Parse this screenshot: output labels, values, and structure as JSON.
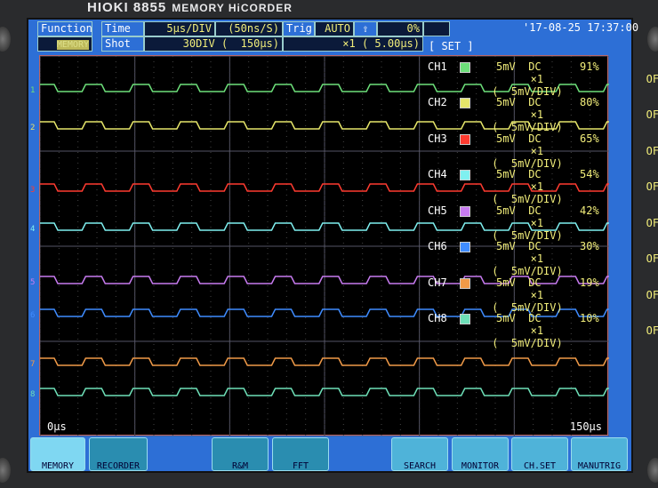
{
  "device": {
    "brand": "HIOKI",
    "model": "8855",
    "name": "MEMORY HiCORDER"
  },
  "header": {
    "function_label": "Function",
    "function_value": "MEMORY",
    "time_label": "Time",
    "time_value": "5µs/DIV",
    "sample_rate": "(50ns/S)",
    "trig_label": "Trig",
    "trig_mode": "AUTO",
    "trig_pct": "0%",
    "shot_label": "Shot",
    "shot_value": "30DIV (  150µs)",
    "mag": "×1 ( 5.00µs)",
    "set": "[ SET ]",
    "datetime": "'17-08-25 17:37:00"
  },
  "plot": {
    "x_start": "0µs",
    "x_end": "150µs"
  },
  "channels": [
    {
      "name": "CH1",
      "num": "1",
      "color": "#6de07a",
      "range": "5mV",
      "coupling": "DC",
      "mult": "×1",
      "div": "(  5mV/DIV)",
      "pos": "91%",
      "filter": "OFF"
    },
    {
      "name": "CH2",
      "num": "2",
      "color": "#e6e66a",
      "range": "5mV",
      "coupling": "DC",
      "mult": "×1",
      "div": "(  5mV/DIV)",
      "pos": "80%",
      "filter": "OFF"
    },
    {
      "name": "CH3",
      "num": "3",
      "color": "#ff3b30",
      "range": "5mV",
      "coupling": "DC",
      "mult": "×1",
      "div": "(  5mV/DIV)",
      "pos": "65%",
      "filter": "OFF"
    },
    {
      "name": "CH4",
      "num": "4",
      "color": "#7ff0f0",
      "range": "5mV",
      "coupling": "DC",
      "mult": "×1",
      "div": "(  5mV/DIV)",
      "pos": "54%",
      "filter": "OFF"
    },
    {
      "name": "CH5",
      "num": "5",
      "color": "#c77bf0",
      "range": "5mV",
      "coupling": "DC",
      "mult": "×1",
      "div": "(  5mV/DIV)",
      "pos": "42%",
      "filter": "OFF"
    },
    {
      "name": "CH6",
      "num": "6",
      "color": "#3f8cff",
      "range": "5mV",
      "coupling": "DC",
      "mult": "×1",
      "div": "(  5mV/DIV)",
      "pos": "30%",
      "filter": "OFF"
    },
    {
      "name": "CH7",
      "num": "7",
      "color": "#f09a48",
      "range": "5mV",
      "coupling": "DC",
      "mult": "×1",
      "div": "(  5mV/DIV)",
      "pos": "19%",
      "filter": "OFF"
    },
    {
      "name": "CH8",
      "num": "8",
      "color": "#6ee0b8",
      "range": "5mV",
      "coupling": "DC",
      "mult": "×1",
      "div": "(  5mV/DIV)",
      "pos": "10%",
      "filter": "OFF"
    }
  ],
  "buttons": {
    "memory": "MEMORY",
    "recorder": "RECORDER",
    "rm": "R&M",
    "fft": "FFT",
    "search": "SEARCH",
    "monitor": "MONITOR",
    "chset": "CH.SET",
    "manutrig": "MANUTRIG"
  }
}
